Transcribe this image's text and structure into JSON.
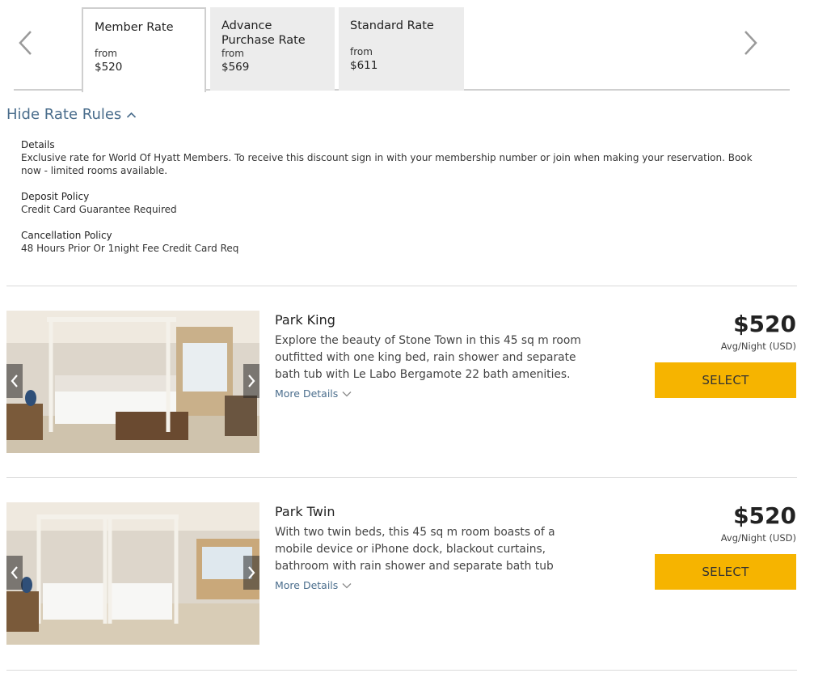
{
  "rate_tabs": [
    {
      "name": "Member Rate",
      "from": "from",
      "price": "$520"
    },
    {
      "name": "Advance Purchase Rate",
      "from": "from",
      "price": "$569"
    },
    {
      "name": "Standard Rate",
      "from": "from",
      "price": "$611"
    }
  ],
  "rules_toggle": "Hide Rate Rules",
  "rules": [
    {
      "title": "Details",
      "body": "Exclusive rate for World Of Hyatt Members. To receive this discount sign in with your membership number or join when making your reservation. Book now - limited rooms available."
    },
    {
      "title": "Deposit Policy",
      "body": "Credit Card Guarantee Required"
    },
    {
      "title": "Cancellation Policy",
      "body": "48 Hours Prior Or 1night Fee Credit Card Req"
    }
  ],
  "rooms": [
    {
      "name": "Park King",
      "description": "Explore the beauty of Stone Town in this 45 sq m room outfitted with one king bed, rain shower and separate bath tub with Le Labo Bergamote 22 bath amenities.",
      "more_details": "More Details",
      "price": "$520",
      "per_night": "Avg/Night (USD)",
      "select": "SELECT"
    },
    {
      "name": "Park Twin",
      "description": "With two twin beds, this 45 sq m room boasts of a mobile device or iPhone dock, blackout curtains, bathroom with rain shower and separate bath tub",
      "more_details": "More Details",
      "price": "$520",
      "per_night": "Avg/Night (USD)",
      "select": "SELECT"
    }
  ],
  "colors": {
    "link": "#4a6d8c",
    "select_button": "#f6b400",
    "tab_inactive": "#ececec"
  }
}
